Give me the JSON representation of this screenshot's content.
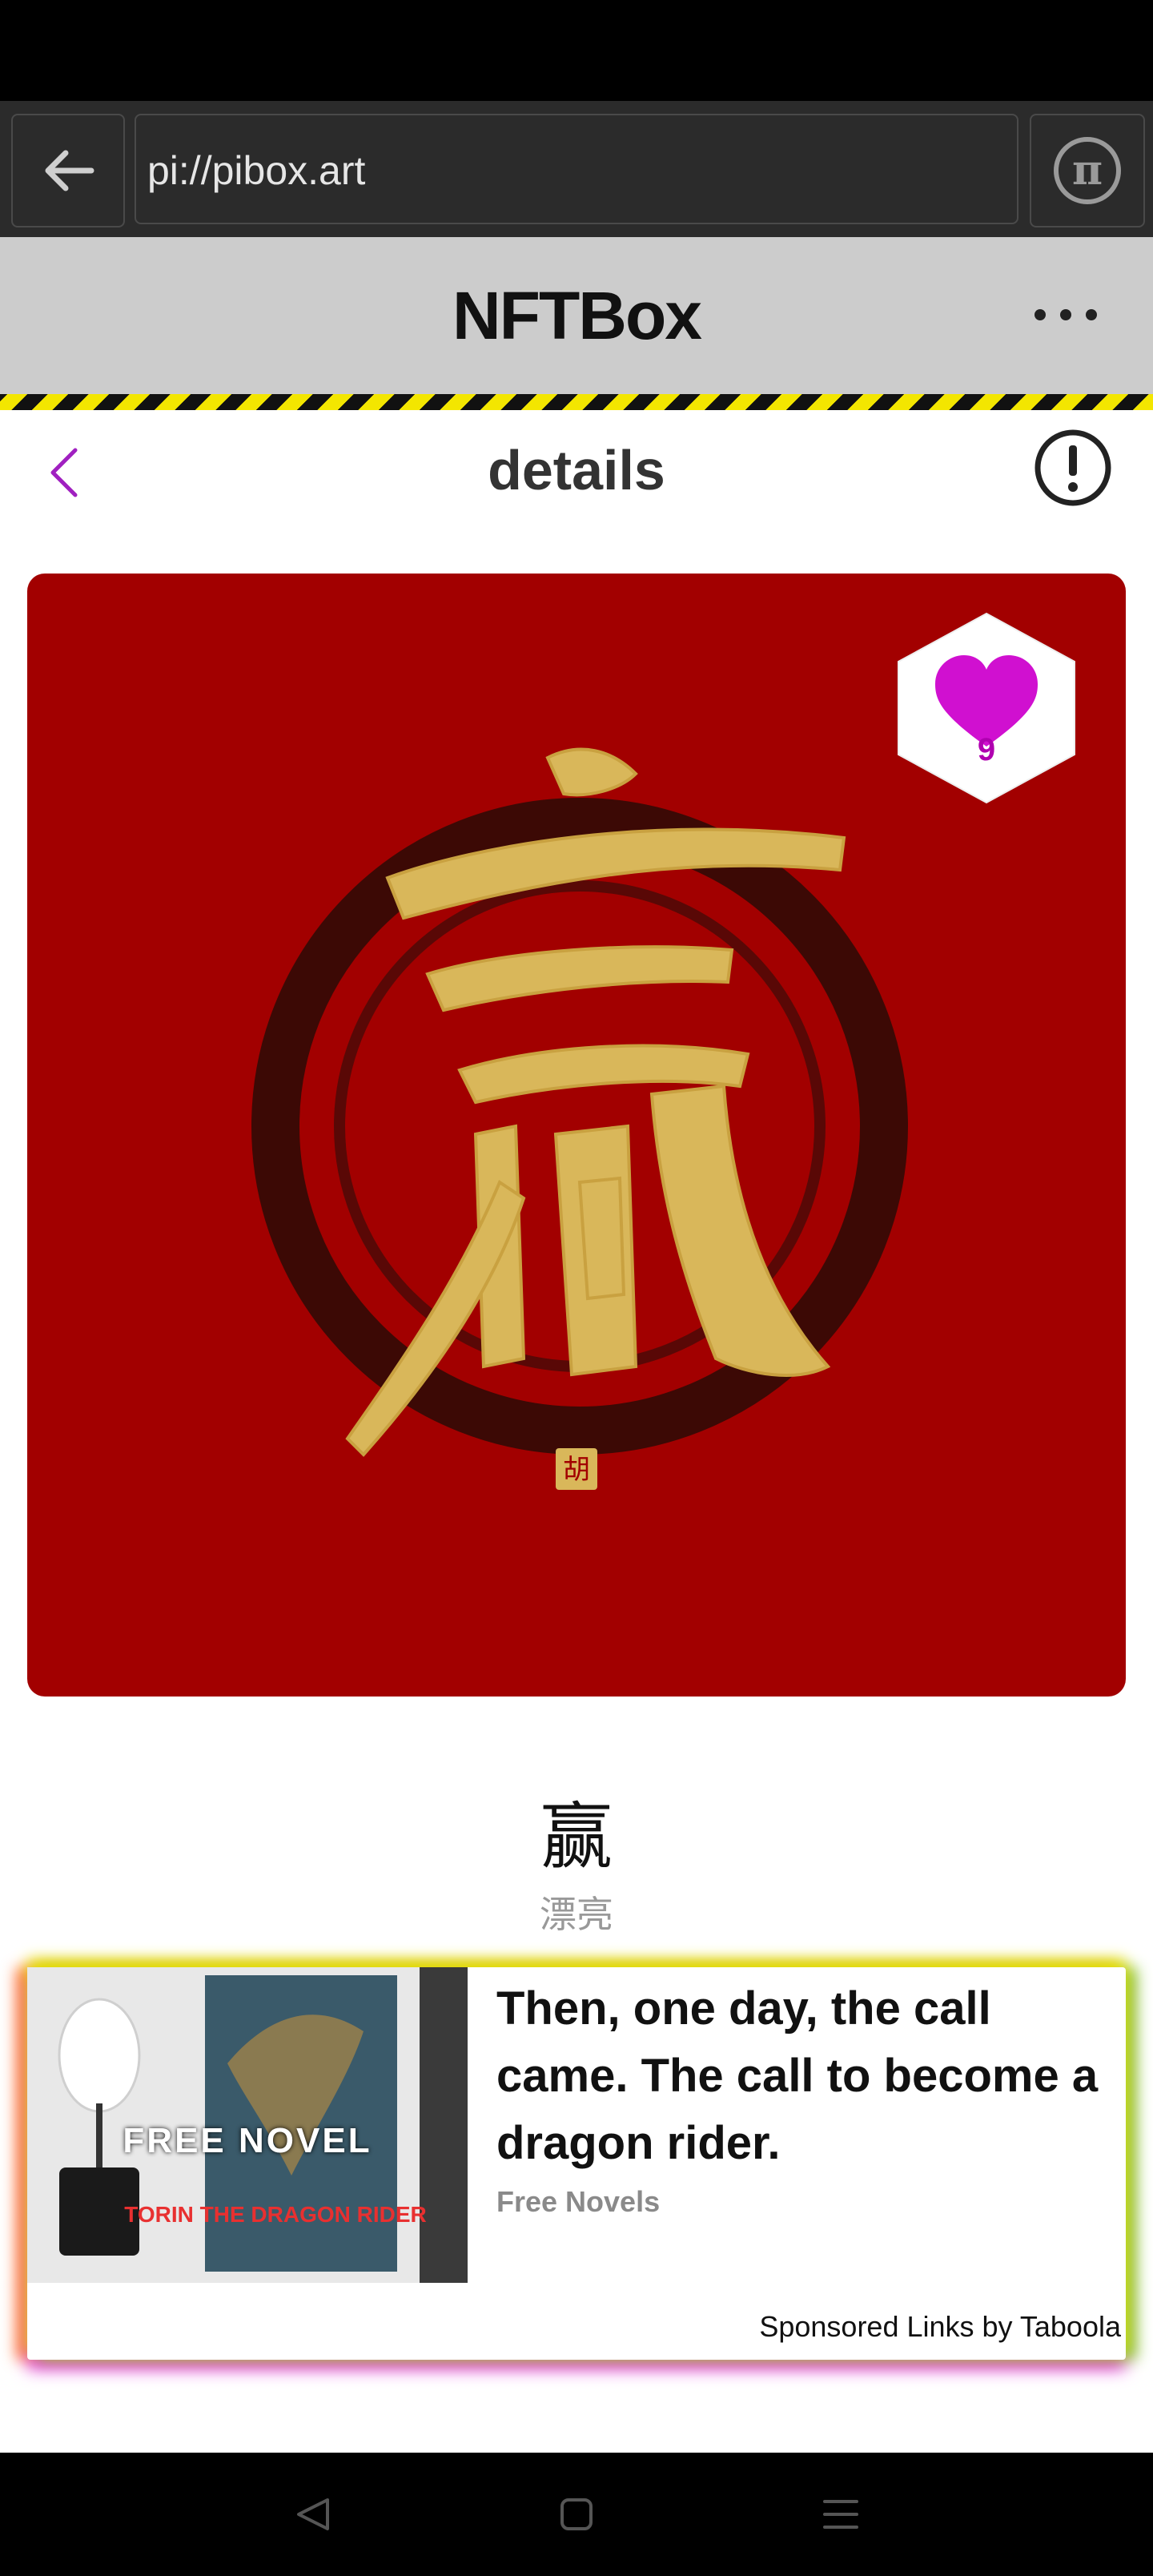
{
  "browser": {
    "url": "pi://pibox.art",
    "back_icon": "arrow-left-icon",
    "pi_icon": "pi-browser-icon",
    "pi_glyph": "π"
  },
  "app": {
    "title": "NFTBox",
    "more_icon": "more-dots-icon"
  },
  "page": {
    "title": "details",
    "back_icon": "chevron-left-icon",
    "info_icon": "info-icon",
    "accent_color": "#a020c0"
  },
  "nft": {
    "artwork": "gold calligraphy character on red background",
    "background_color": "#a20000",
    "like_count": "9",
    "name": "赢",
    "subtitle": "漂亮"
  },
  "ad": {
    "image_label": "FREE NOVEL",
    "book_title": "TORIN THE DRAGON RIDER",
    "headline": "Then, one day, the call came. The call to become a dragon rider.",
    "source": "Free Novels",
    "sponsored": "Sponsored Links by Taboola"
  },
  "nav": {
    "back_icon": "nav-back-icon",
    "home_icon": "nav-home-icon",
    "menu_icon": "nav-menu-icon"
  }
}
